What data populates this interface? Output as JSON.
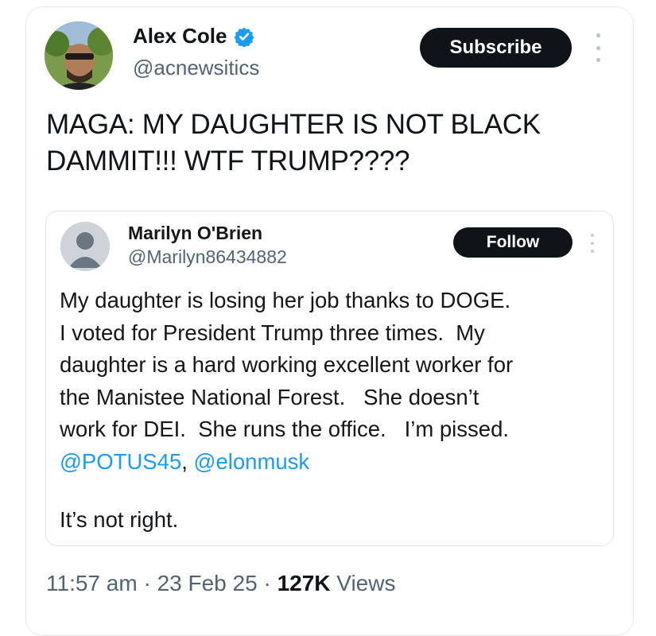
{
  "author": {
    "name": "Alex Cole",
    "handle": "@acnewsitics",
    "verified": true
  },
  "actions": {
    "subscribe_label": "Subscribe"
  },
  "tweet": {
    "line1": "MAGA: MY DAUGHTER IS NOT BLACK",
    "line2": "DAMMIT!!! WTF TRUMP????"
  },
  "quoted": {
    "name": "Marilyn O'Brien",
    "handle": "@Marilyn86434882",
    "follow_label": "Follow",
    "lines": [
      "My daughter is losing her job thanks to DOGE.",
      "I voted for President Trump three times.  My",
      "daughter is a hard working excellent worker for",
      "the Manistee National Forest.   She doesn’t",
      "work for DEI.  She runs the office.   I’m pissed."
    ],
    "mention1": "@POTUS45",
    "mention_sep": ", ",
    "mention2": "@elonmusk",
    "closing": "It’s not right."
  },
  "meta": {
    "time": "11:57 am",
    "sep1": " · ",
    "date": "23 Feb 25",
    "sep2": " · ",
    "views_count": "127K",
    "views_label": " Views"
  },
  "colors": {
    "button_bg": "#0f1419",
    "mention": "#1d9bf0",
    "secondary_text": "#536471",
    "verified": "#1d9bf0"
  }
}
